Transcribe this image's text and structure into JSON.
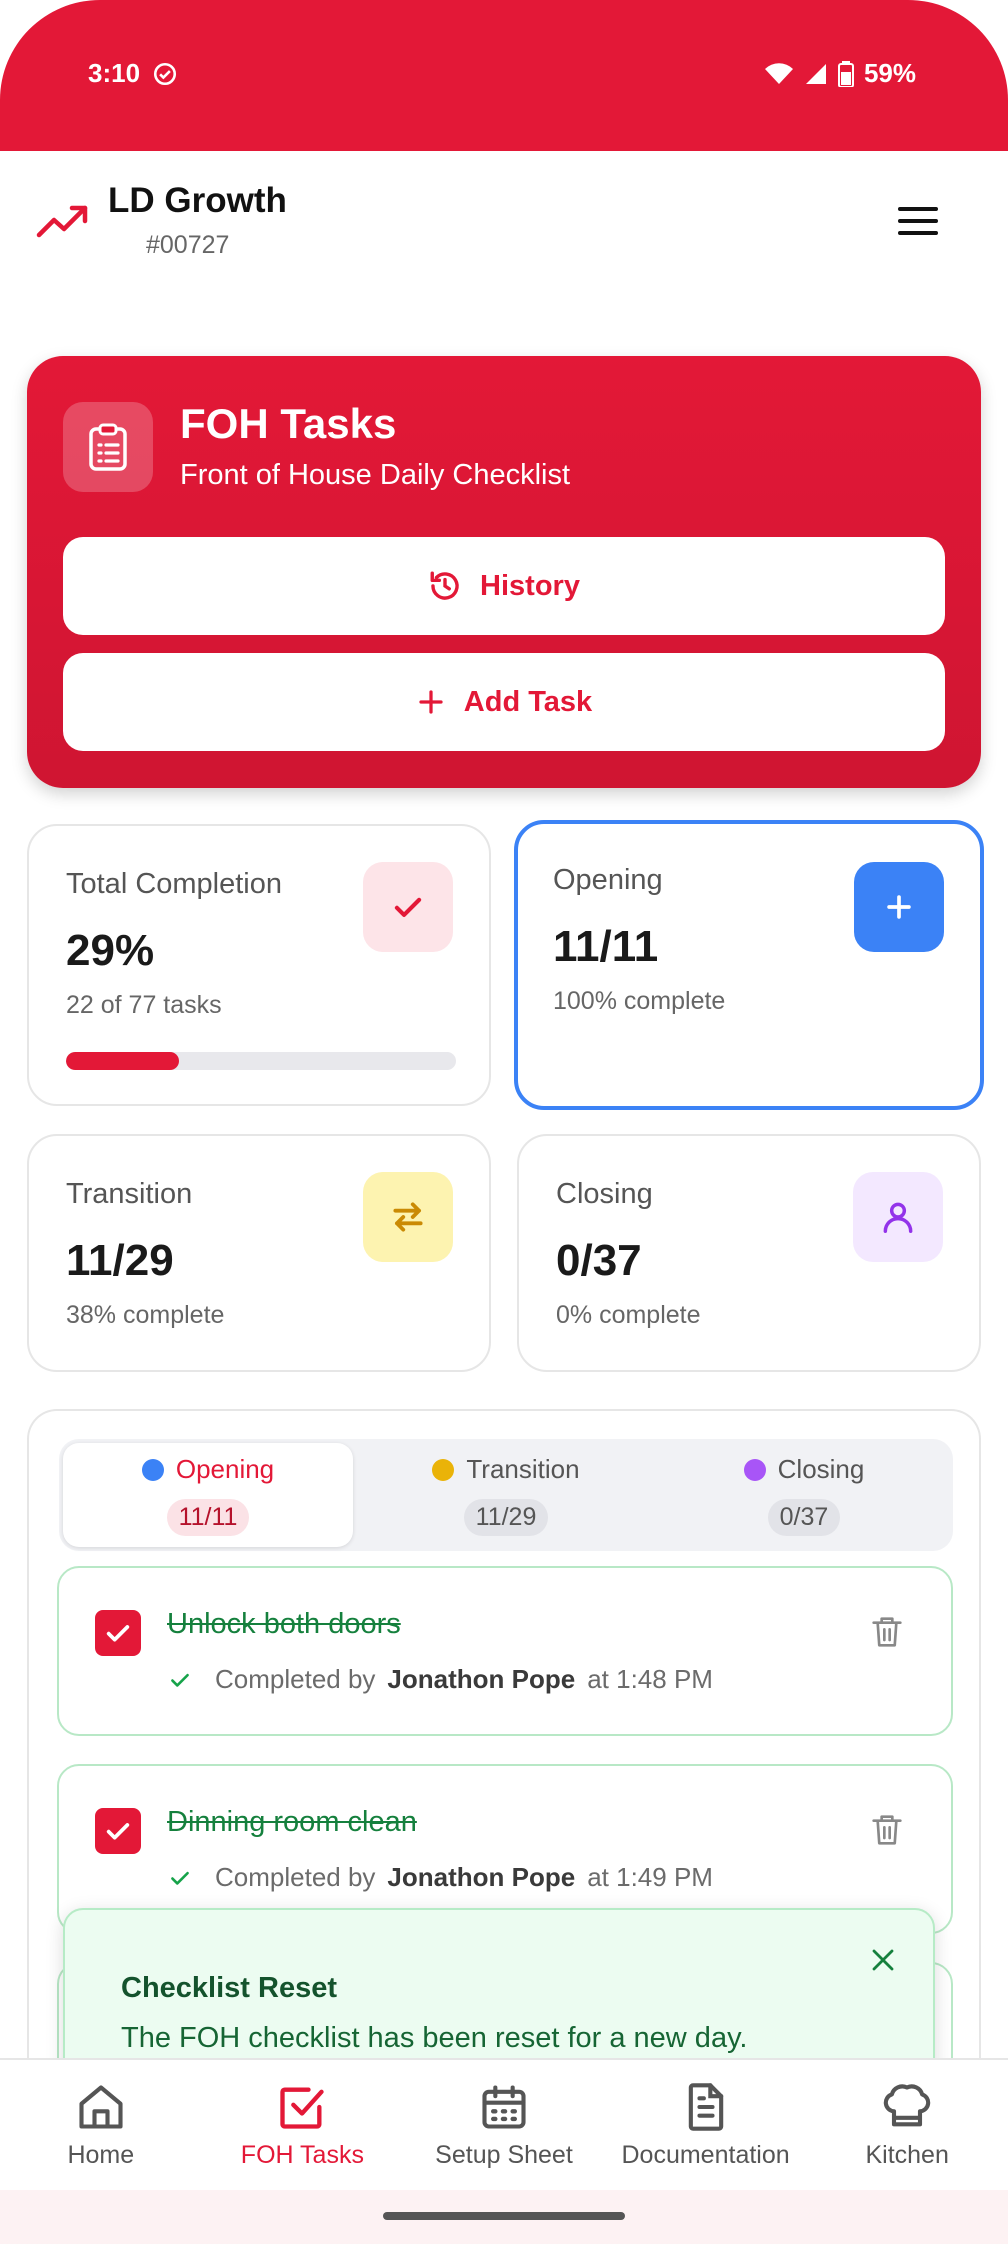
{
  "status_bar": {
    "time": "3:10",
    "battery": "59%"
  },
  "header": {
    "brand": "LD Growth",
    "store_id": "#00727"
  },
  "hero": {
    "title": "FOH Tasks",
    "subtitle": "Front of House Daily Checklist",
    "history_label": "History",
    "add_task_label": "Add Task"
  },
  "stats": {
    "total": {
      "label": "Total Completion",
      "value": "29%",
      "note": "22 of 77 tasks",
      "progress": 0.29
    },
    "opening": {
      "label": "Opening",
      "value": "11/11",
      "note": "100% complete"
    },
    "transition": {
      "label": "Transition",
      "value": "11/29",
      "note": "38% complete"
    },
    "closing": {
      "label": "Closing",
      "value": "0/37",
      "note": "0% complete"
    }
  },
  "tabs": [
    {
      "label": "Opening",
      "count": "11/11",
      "color": "#3b82f6"
    },
    {
      "label": "Transition",
      "count": "11/29",
      "color": "#eab308"
    },
    {
      "label": "Closing",
      "count": "0/37",
      "color": "#a855f7"
    }
  ],
  "tasks": [
    {
      "title": "Unlock both doors",
      "completed_prefix": "Completed by",
      "user": "Jonathon Pope",
      "time_text": "at 1:48 PM"
    },
    {
      "title": "Dinning room clean",
      "completed_prefix": "Completed by",
      "user": "Jonathon Pope",
      "time_text": "at 1:49 PM"
    }
  ],
  "toast": {
    "title": "Checklist Reset",
    "message": "The FOH checklist has been reset for a new day."
  },
  "bottom_nav": [
    {
      "label": "Home",
      "icon": "home-icon"
    },
    {
      "label": "FOH Tasks",
      "icon": "checkbox-icon"
    },
    {
      "label": "Setup Sheet",
      "icon": "calendar-icon"
    },
    {
      "label": "Documentation",
      "icon": "document-icon"
    },
    {
      "label": "Kitchen",
      "icon": "chef-hat-icon"
    }
  ],
  "colors": {
    "brand": "#e31837",
    "accent_blue": "#3b82f6",
    "success": "#15803d"
  }
}
